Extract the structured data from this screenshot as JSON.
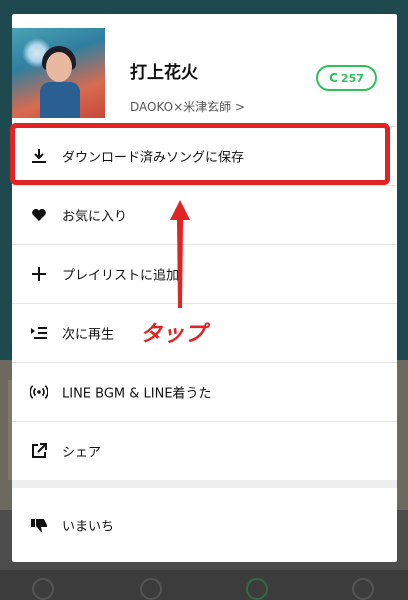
{
  "song": {
    "title": "打上花火",
    "artist": "DAOKO×米津玄師 >",
    "coin_value": "257",
    "coin_icon": "C"
  },
  "menu": [
    {
      "label": "ダウンロード済みソングに保存",
      "icon": "download-icon"
    },
    {
      "label": "お気に入り",
      "icon": "heart-icon"
    },
    {
      "label": "プレイリストに追加",
      "icon": "plus-icon"
    },
    {
      "label": "次に再生",
      "icon": "play-next-icon"
    },
    {
      "label": "LINE BGM & LINE着うた",
      "icon": "broadcast-icon"
    },
    {
      "label": "シェア",
      "icon": "share-icon"
    },
    {
      "label": "いまいち",
      "icon": "thumbs-down-icon"
    }
  ],
  "annotation": {
    "label": "タップ",
    "color": "#e22323"
  },
  "colors": {
    "accent_green": "#2fc15a",
    "highlight_red": "#e22323"
  }
}
